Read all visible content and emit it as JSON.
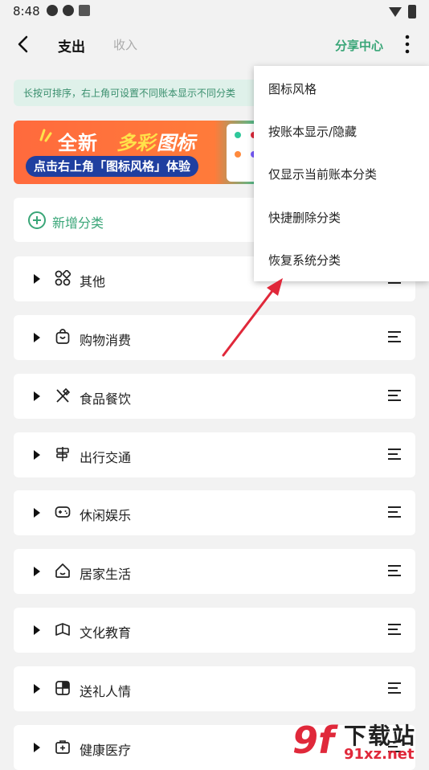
{
  "status_bar": {
    "time": "8:48"
  },
  "header": {
    "tab_expense": "支出",
    "tab_income": "收入",
    "share": "分享中心"
  },
  "tip": "长按可排序，右上角可设置不同账本显示不同分类",
  "banner": {
    "title_a": "全新",
    "title_b": "多彩",
    "title_c": "图标",
    "subtitle": "点击右上角「图标风格」体验"
  },
  "add_category": "新增分类",
  "categories": [
    {
      "label": "其他",
      "icon": "apps-icon"
    },
    {
      "label": "购物消费",
      "icon": "shopping-bag-icon"
    },
    {
      "label": "食品餐饮",
      "icon": "fork-knife-icon"
    },
    {
      "label": "出行交通",
      "icon": "signpost-icon"
    },
    {
      "label": "休闲娱乐",
      "icon": "gamepad-icon"
    },
    {
      "label": "居家生活",
      "icon": "house-icon"
    },
    {
      "label": "文化教育",
      "icon": "book-icon"
    },
    {
      "label": "送礼人情",
      "icon": "gift-icon"
    },
    {
      "label": "健康医疗",
      "icon": "medical-kit-icon"
    }
  ],
  "menu": [
    "图标风格",
    "按账本显示/隐藏",
    "仅显示当前账本分类",
    "快捷删除分类",
    "恢复系统分类"
  ],
  "watermark": {
    "a": "9f",
    "b": "下载站",
    "c": "91xz.net"
  },
  "colors": {
    "accent": "#3aa678",
    "arrow": "#e0283a"
  }
}
